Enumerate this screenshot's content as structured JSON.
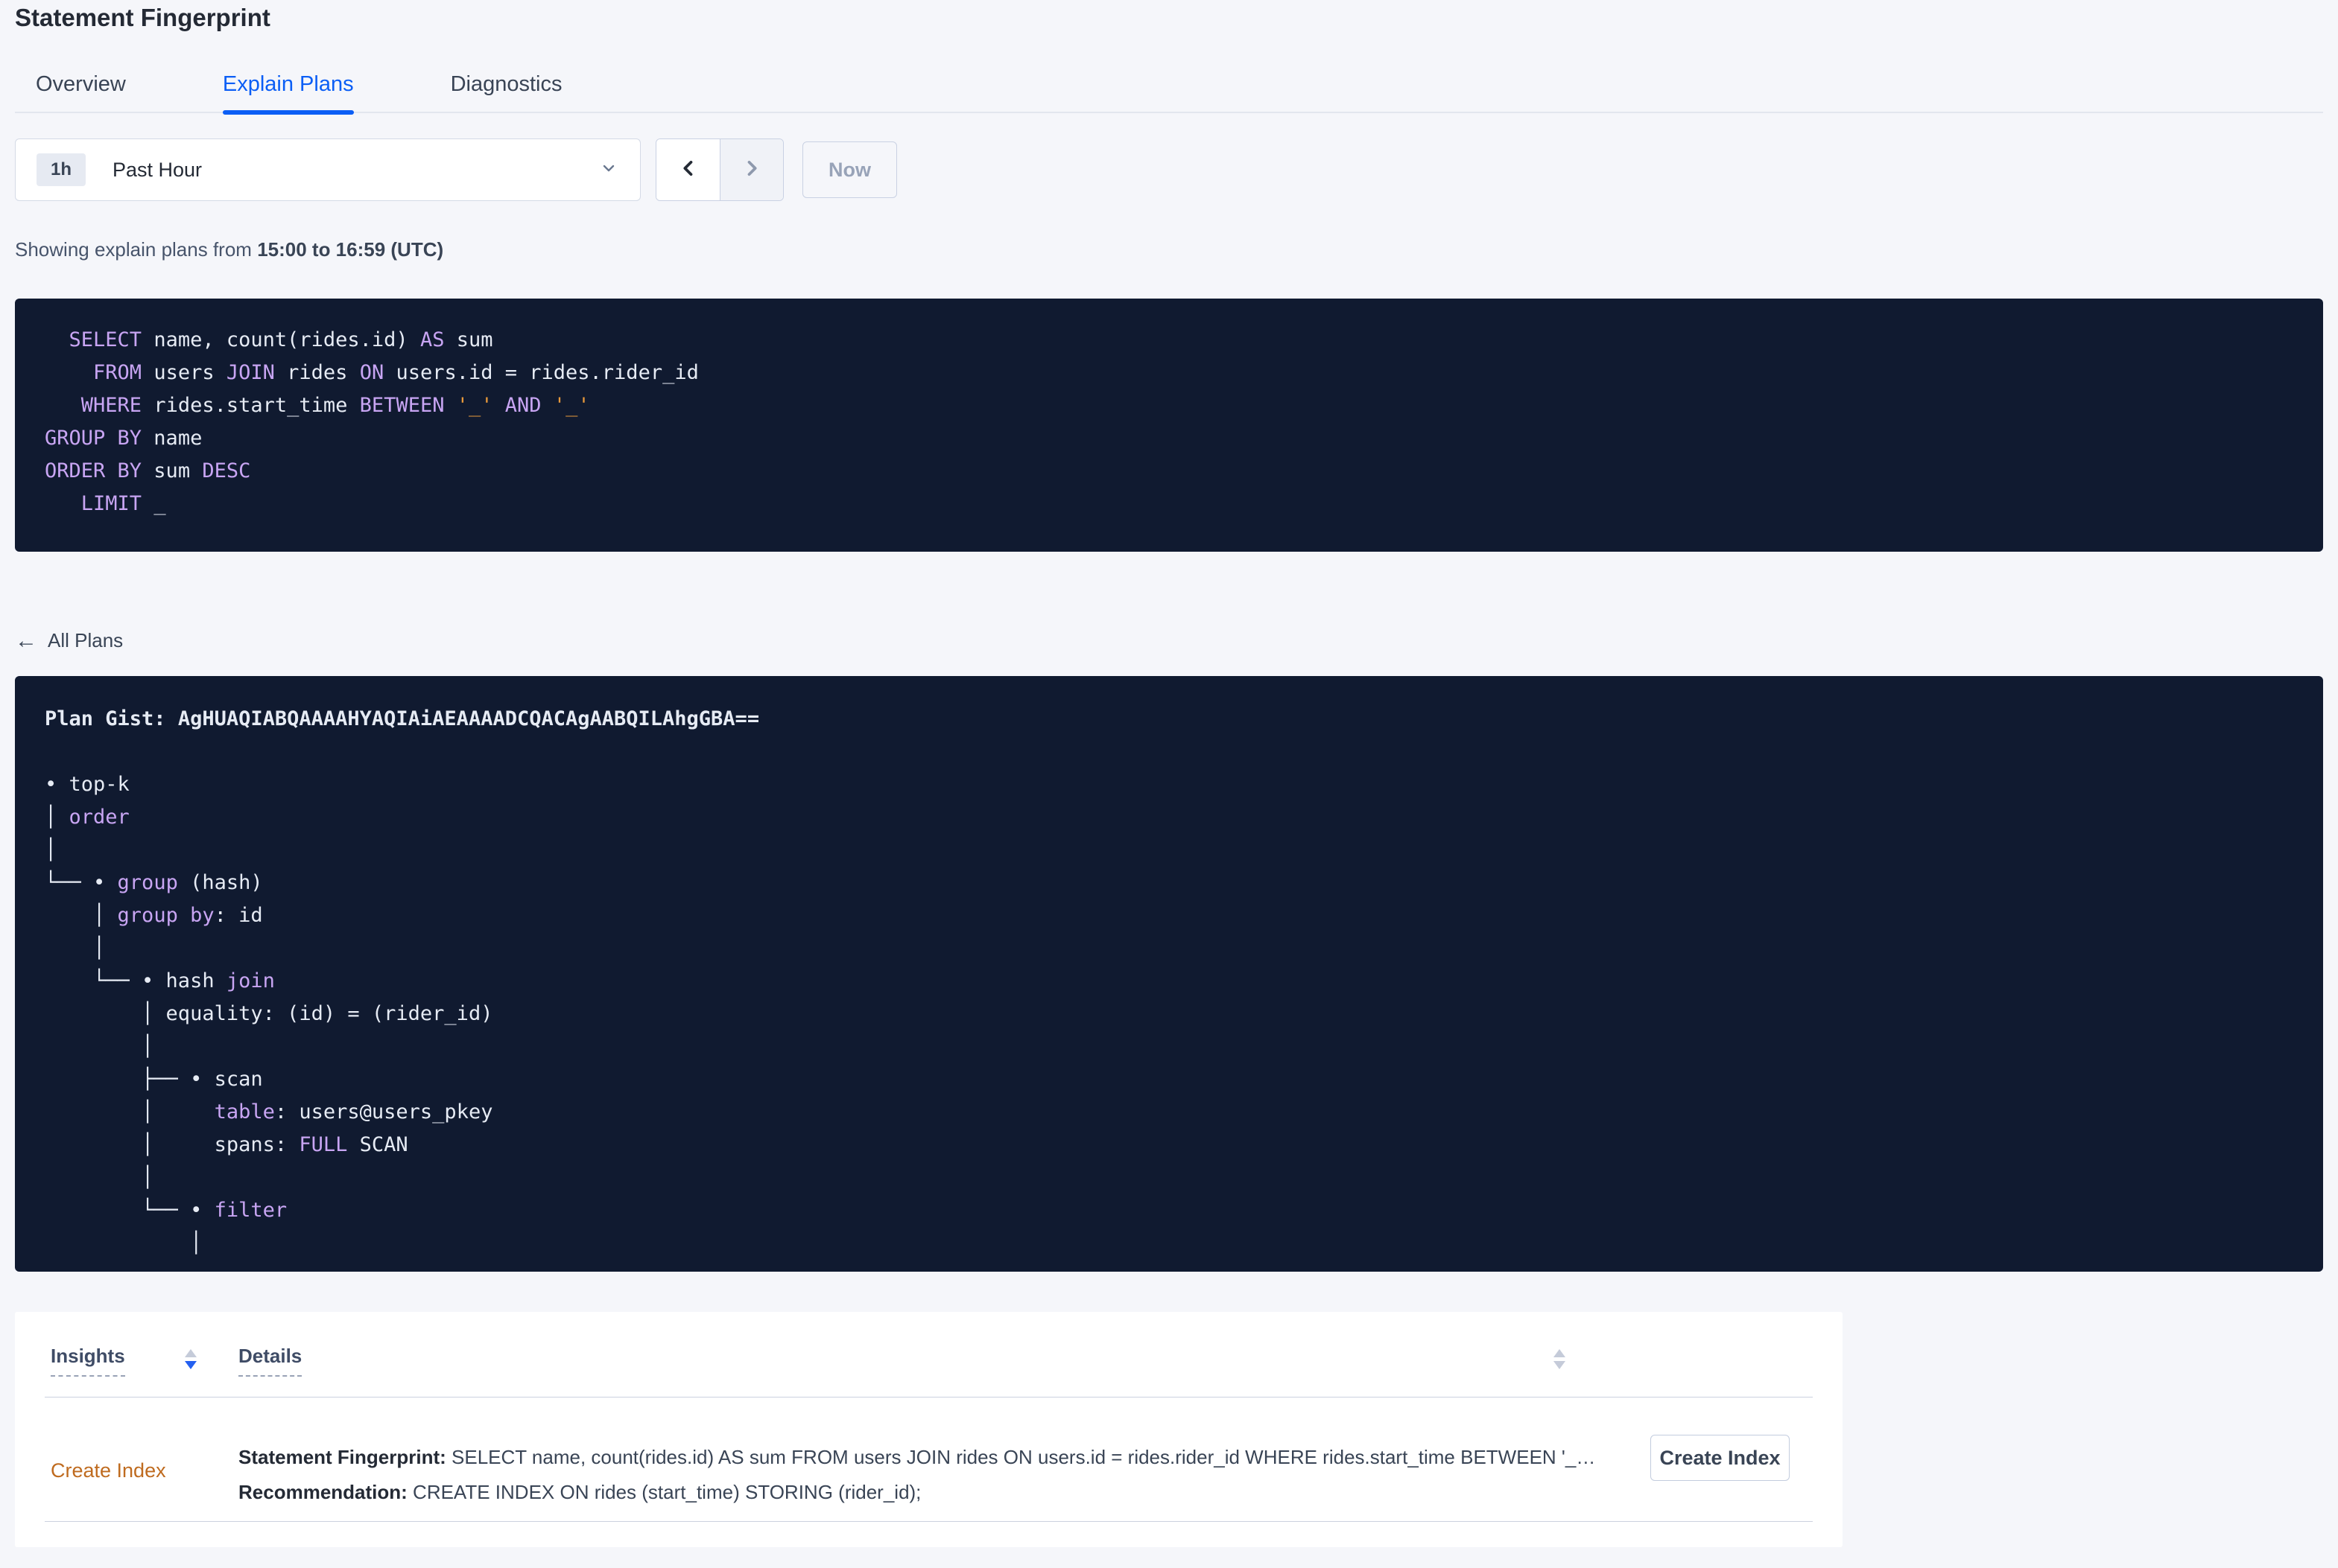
{
  "colors": {
    "accent_blue": "#0b5ef5",
    "sort_active_blue": "#2460f0",
    "keyword_purple": "#c8a5f3",
    "literal_orange": "#e8993b",
    "link_orange": "#bf6b1f",
    "code_bg": "#101a30",
    "code_fg": "#e6ebf4"
  },
  "page": {
    "title": "Statement Fingerprint"
  },
  "tabs": [
    {
      "label": "Overview"
    },
    {
      "label": "Explain Plans"
    },
    {
      "label": "Diagnostics"
    }
  ],
  "time_picker": {
    "badge": "1h",
    "label": "Past Hour",
    "now_label": "Now"
  },
  "showing": {
    "prefix": "Showing explain plans from ",
    "range": "15:00 to 16:59 (UTC)"
  },
  "sql": {
    "lines": [
      [
        {
          "t": "  "
        },
        {
          "t": "SELECT",
          "c": "kw"
        },
        {
          "t": " name, count(rides.id) "
        },
        {
          "t": "AS",
          "c": "kw"
        },
        {
          "t": " sum"
        }
      ],
      [
        {
          "t": "    "
        },
        {
          "t": "FROM",
          "c": "kw"
        },
        {
          "t": " users "
        },
        {
          "t": "JOIN",
          "c": "kw"
        },
        {
          "t": " rides "
        },
        {
          "t": "ON",
          "c": "kw"
        },
        {
          "t": " users.id = rides.rider_id"
        }
      ],
      [
        {
          "t": "   "
        },
        {
          "t": "WHERE",
          "c": "kw"
        },
        {
          "t": " rides.start_time "
        },
        {
          "t": "BETWEEN",
          "c": "kw"
        },
        {
          "t": " "
        },
        {
          "t": "'_'",
          "c": "lit"
        },
        {
          "t": " "
        },
        {
          "t": "AND",
          "c": "kw"
        },
        {
          "t": " "
        },
        {
          "t": "'_'",
          "c": "lit"
        }
      ],
      [
        {
          "t": "GROUP BY",
          "c": "kw"
        },
        {
          "t": " name"
        }
      ],
      [
        {
          "t": "ORDER BY",
          "c": "kw"
        },
        {
          "t": " sum "
        },
        {
          "t": "DESC",
          "c": "kw"
        }
      ],
      [
        {
          "t": "   "
        },
        {
          "t": "LIMIT",
          "c": "kw"
        },
        {
          "t": " _"
        }
      ]
    ]
  },
  "all_plans": {
    "label": "All Plans",
    "arrow": "←"
  },
  "plan": {
    "gist_label": "Plan Gist: ",
    "gist": "AgHUAQIABQAAAAHYAQIAiAEAAAADCQACAgAABQILAhgGBA==",
    "tree_lines": [
      [
        {
          "t": "• top-k"
        }
      ],
      [
        {
          "t": "│ "
        },
        {
          "t": "order",
          "c": "kw"
        }
      ],
      [
        {
          "t": "│"
        }
      ],
      [
        {
          "t": "└── • "
        },
        {
          "t": "group",
          "c": "kw"
        },
        {
          "t": " (hash)"
        }
      ],
      [
        {
          "t": "    │ "
        },
        {
          "t": "group by",
          "c": "kw"
        },
        {
          "t": ": id"
        }
      ],
      [
        {
          "t": "    │"
        }
      ],
      [
        {
          "t": "    └── • hash "
        },
        {
          "t": "join",
          "c": "kw"
        }
      ],
      [
        {
          "t": "        │ equality: (id) = (rider_id)"
        }
      ],
      [
        {
          "t": "        │"
        }
      ],
      [
        {
          "t": "        ├── • scan"
        }
      ],
      [
        {
          "t": "        │     "
        },
        {
          "t": "table",
          "c": "kw"
        },
        {
          "t": ": users@users_pkey"
        }
      ],
      [
        {
          "t": "        │     spans: "
        },
        {
          "t": "FULL",
          "c": "kw"
        },
        {
          "t": " SCAN"
        }
      ],
      [
        {
          "t": "        │"
        }
      ],
      [
        {
          "t": "        └── • "
        },
        {
          "t": "filter",
          "c": "kw"
        }
      ],
      [
        {
          "t": "            │"
        }
      ]
    ]
  },
  "insights_table": {
    "columns": {
      "insights": "Insights",
      "details": "Details"
    },
    "row": {
      "insight": "Create Index",
      "fingerprint_label": "Statement Fingerprint:",
      "fingerprint_text": " SELECT name, count(rides.id) AS sum FROM users JOIN rides ON users.id = rides.rider_id WHERE rides.start_time BETWEEN '_…",
      "recommendation_label": "Recommendation:",
      "recommendation_text": " CREATE INDEX ON rides (start_time) STORING (rider_id);",
      "action_label": "Create Index"
    }
  }
}
